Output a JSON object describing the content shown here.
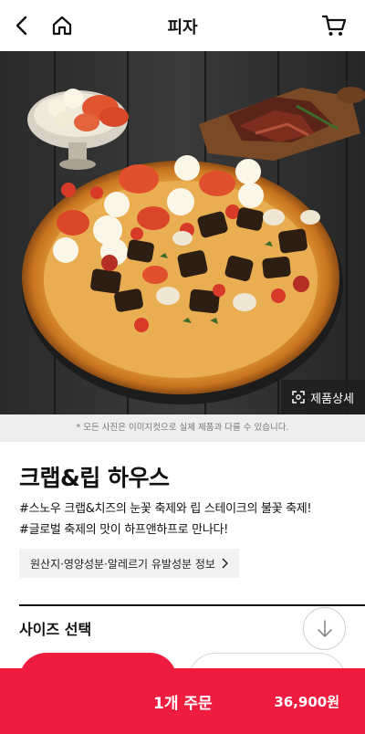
{
  "header": {
    "title": "피자",
    "back_icon": "chevron-left-icon",
    "home_icon": "home-icon",
    "cart_icon": "cart-icon"
  },
  "hero": {
    "detail_label": "제품상세",
    "detail_icon": "expand-icon",
    "disclaimer": "* 모든 사진은 이미지컷으로 실제 제품과 다를 수 있습니다."
  },
  "product": {
    "name": "크랩&립 하우스",
    "desc_line1": "#스노우 크랩&치즈의 눈꽃 축제와 립 스테이크의 불꽃 축제!",
    "desc_line2": "#글로벌 축제의 맛이 하프앤하프로 만나다!",
    "info_label": "원산지·영양성분·알레르기 유발성분 정보"
  },
  "size": {
    "title": "사이즈 선택",
    "scroll_icon": "arrow-down-icon"
  },
  "order": {
    "label": "1개 주문",
    "price": "36,900원"
  },
  "colors": {
    "accent": "#ee1d3f",
    "disclaimer_bg": "#eeeeee"
  }
}
